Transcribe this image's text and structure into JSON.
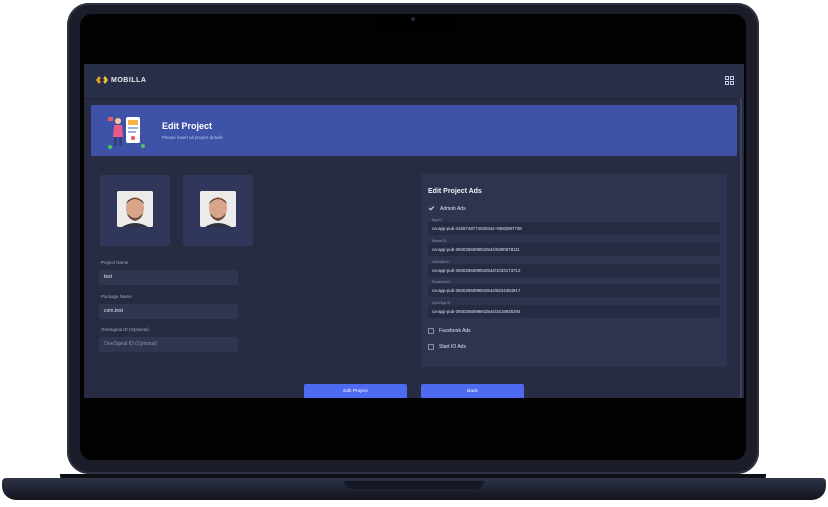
{
  "header": {
    "logo_text": "MOBILLA",
    "menu_icon": "grid-icon"
  },
  "banner": {
    "title": "Edit Project",
    "subtitle": "Please insert all project details"
  },
  "images": [
    {
      "name": "project-image-1",
      "icon": "person-photo"
    },
    {
      "name": "project-image-2",
      "icon": "person-photo"
    }
  ],
  "form": {
    "project_name_label": "Project Name",
    "project_name_value": "test",
    "package_name_label": "Package Name",
    "package_name_value": "com.test",
    "onesignal_label": "OneSignal ID (Optional)",
    "onesignal_placeholder": "OneSignal ID (Optional)"
  },
  "ads": {
    "title": "Edit Project Ads",
    "admob": {
      "label": "Admob Ads",
      "checked": true
    },
    "fields": [
      {
        "label": "App ID",
        "value": "ca-app-pub-4159748774630342~9582597738"
      },
      {
        "label": "Banner ID",
        "value": "ca-app-pub-3940256099942544/6300978111"
      },
      {
        "label": "Interstitial ID",
        "value": "ca-app-pub-3940256099942544/1033173712"
      },
      {
        "label": "Rewarded ID",
        "value": "ca-app-pub-3940256099942544/5224354917"
      },
      {
        "label": "Open App ID",
        "value": "ca-app-pub-3940256099942544/3419835294"
      }
    ],
    "facebook": {
      "label": "Facebook Ads",
      "checked": false
    },
    "startio": {
      "label": "Start IO Ads",
      "checked": false
    }
  },
  "buttons": {
    "submit": "Edit Project",
    "back": "Back"
  },
  "colors": {
    "accent": "#4e6af0",
    "banner": "#3e52a8",
    "background": "#272c42",
    "panel": "#2e3450"
  }
}
